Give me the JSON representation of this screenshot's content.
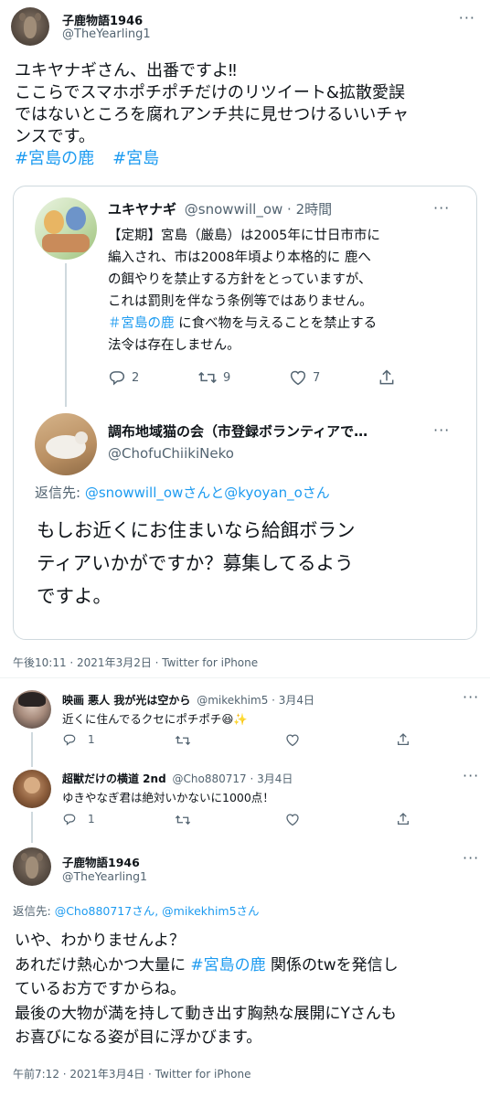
{
  "main_tweet": {
    "name": "子鹿物語1946",
    "handle": "@TheYearling1",
    "lines": [
      "ユキヤナギさん、出番ですよ‼",
      "ここらでスマホポチポチだけのリツイート&拡散愛誤",
      "ではないところを腐れアンチ共に見せつけるいいチャ",
      "ンスです。"
    ],
    "hashtag1": "#宮島の鹿",
    "hashtag2": "#宮島",
    "timestamp": "午後10:11 · 2021年3月2日 · Twitter for iPhone"
  },
  "quote": {
    "name": "ユキヤナギ",
    "handle_time": "@snowwill_ow · 2時間",
    "lines": [
      "【定期】宮島（厳島）は2005年に廿日市市に",
      "編入され、市は2008年頃より本格的に 鹿へ",
      "の餌やりを禁止する方針をとっていますが、",
      "これは罰則を伴なう条例等ではありません。"
    ],
    "line5_tag": "＃宮島の鹿",
    "line5_rest": " に食べ物を与えることを禁止する",
    "line6": "法令は存在しません。",
    "reply_count": "2",
    "retweet_count": "9",
    "like_count": "7",
    "reply": {
      "name": "調布地域猫の会（市登録ボランティアで…",
      "handle": "@ChofuChiikiNeko",
      "replying_label": "返信先: ",
      "replying_to": "@snowwill_owさんと@kyoyan_oさん",
      "lines": [
        "もしお近くにお住まいなら給餌ボラン",
        "ティアいかがですか？募集してるよう",
        "ですよ。"
      ]
    }
  },
  "reply1": {
    "name": "映画 悪人 我が光は空から",
    "handle_time": "@mikekhim5 · 3月4日",
    "text": "近くに住んでるクセにポチポチ😆✨",
    "reply_count": "1"
  },
  "reply2": {
    "name": "超獣だけの横道 2nd",
    "handle_time": "@Cho880717 · 3月4日",
    "text": "ゆきやなぎ君は絶対いかないに1000点！",
    "reply_count": "1"
  },
  "reply3": {
    "name": "子鹿物語1946",
    "handle": "@TheYearling1",
    "replying_label": "返信先: ",
    "replying_to": "@Cho880717さん, @mikekhim5さん",
    "line1": "いや、わかりませんよ？",
    "line2_pre": "あれだけ熱心かつ大量に ",
    "line2_tag": "#宮島の鹿",
    "line2_post": " 関係のtwを発信し",
    "line3": "ているお方ですからね。",
    "line4": "最後の大物が満を持して動き出す胸熱な展開にYさんも",
    "line5": "お喜びになる姿が目に浮かびます。",
    "timestamp": "午前7:12 · 2021年3月4日 · Twitter for iPhone"
  },
  "more_glyph": "···"
}
